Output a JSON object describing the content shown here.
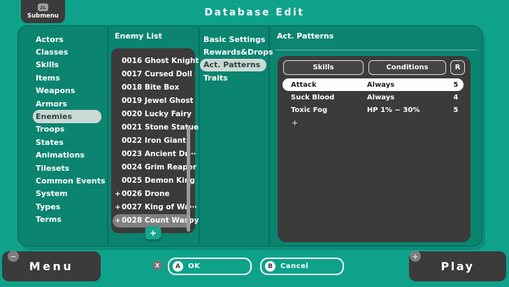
{
  "colors": {
    "background": "#0EA28A",
    "panel": "#0B8470",
    "dark_surface": "#3B3B3B",
    "selection_light": "#CBD9D4",
    "selection_gray": "#808080",
    "selected_row": "#FFFFFF",
    "accent_green": "#17A68E"
  },
  "top_bar": {
    "submenu_button": {
      "badge": "ZL",
      "label": "Submenu"
    },
    "title": "Database Edit"
  },
  "sidebar": {
    "items": [
      {
        "label": "Actors",
        "selected": false
      },
      {
        "label": "Classes",
        "selected": false
      },
      {
        "label": "Skills",
        "selected": false
      },
      {
        "label": "Items",
        "selected": false
      },
      {
        "label": "Weapons",
        "selected": false
      },
      {
        "label": "Armors",
        "selected": false
      },
      {
        "label": "Enemies",
        "selected": true
      },
      {
        "label": "Troops",
        "selected": false
      },
      {
        "label": "States",
        "selected": false
      },
      {
        "label": "Animations",
        "selected": false
      },
      {
        "label": "Tilesets",
        "selected": false
      },
      {
        "label": "Common Events",
        "selected": false
      },
      {
        "label": "System",
        "selected": false
      },
      {
        "label": "Types",
        "selected": false
      },
      {
        "label": "Terms",
        "selected": false
      }
    ]
  },
  "enemy_list": {
    "header": "Enemy List",
    "added_marker": "+",
    "add_button": "+",
    "items": [
      {
        "label": "0016 Ghost Knight",
        "added": false,
        "selected": false
      },
      {
        "label": "0017 Cursed Doll",
        "added": false,
        "selected": false
      },
      {
        "label": "0018 Bite Box",
        "added": false,
        "selected": false
      },
      {
        "label": "0019 Jewel Ghost",
        "added": false,
        "selected": false
      },
      {
        "label": "0020 Lucky Fairy",
        "added": false,
        "selected": false
      },
      {
        "label": "0021 Stone Statue",
        "added": false,
        "selected": false
      },
      {
        "label": "0022 Iron Giant",
        "added": false,
        "selected": false
      },
      {
        "label": "0023 Ancient Dr⋯",
        "added": false,
        "selected": false
      },
      {
        "label": "0024 Grim Reaper",
        "added": false,
        "selected": false
      },
      {
        "label": "0025 Demon King",
        "added": false,
        "selected": false
      },
      {
        "label": "0026 Drone",
        "added": true,
        "selected": false
      },
      {
        "label": "0027 King of Wa⋯",
        "added": true,
        "selected": false
      },
      {
        "label": "0028 Count Waspy",
        "added": true,
        "selected": true
      }
    ]
  },
  "tabs": {
    "items": [
      {
        "label": "Basic Settings",
        "selected": false
      },
      {
        "label": "Rewards&Drops",
        "selected": false
      },
      {
        "label": "Act. Patterns",
        "selected": true
      },
      {
        "label": "Traits",
        "selected": false
      }
    ]
  },
  "act_patterns": {
    "title": "Act. Patterns",
    "columns": {
      "skills": "Skills",
      "conditions": "Conditions",
      "rating": "R"
    },
    "rows": [
      {
        "skill": "Attack",
        "condition": "Always",
        "rating": "5",
        "selected": true
      },
      {
        "skill": "Suck Blood",
        "condition": "Always",
        "rating": "4",
        "selected": false
      },
      {
        "skill": "Toxic Fog",
        "condition": "HP 1% ~ 30%",
        "rating": "5",
        "selected": false
      }
    ],
    "add_label": "+"
  },
  "bottom_bar": {
    "menu": {
      "badge": "−",
      "label": "Menu"
    },
    "x_button": "X",
    "ok": {
      "badge": "A",
      "label": "OK"
    },
    "cancel": {
      "badge": "B",
      "label": "Cancel"
    },
    "play": {
      "badge": "+",
      "label": "Play"
    }
  }
}
